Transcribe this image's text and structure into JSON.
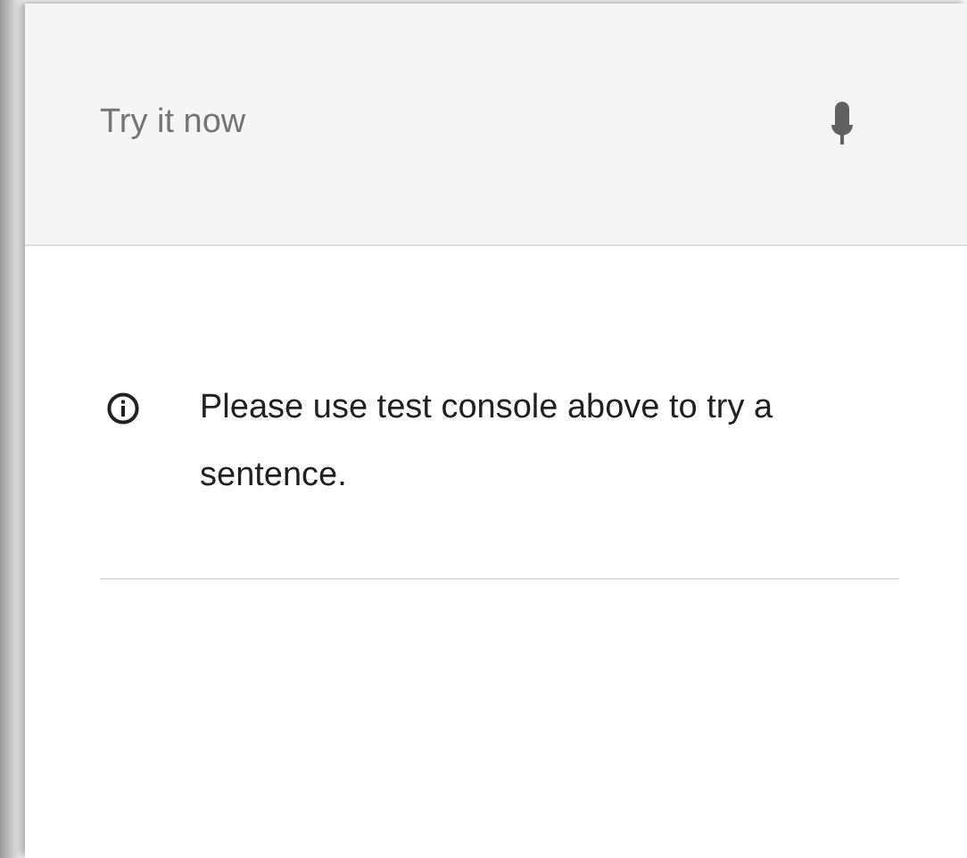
{
  "header": {
    "placeholder": "Try it now"
  },
  "message": {
    "text": "Please use test console above to try a sentence."
  }
}
